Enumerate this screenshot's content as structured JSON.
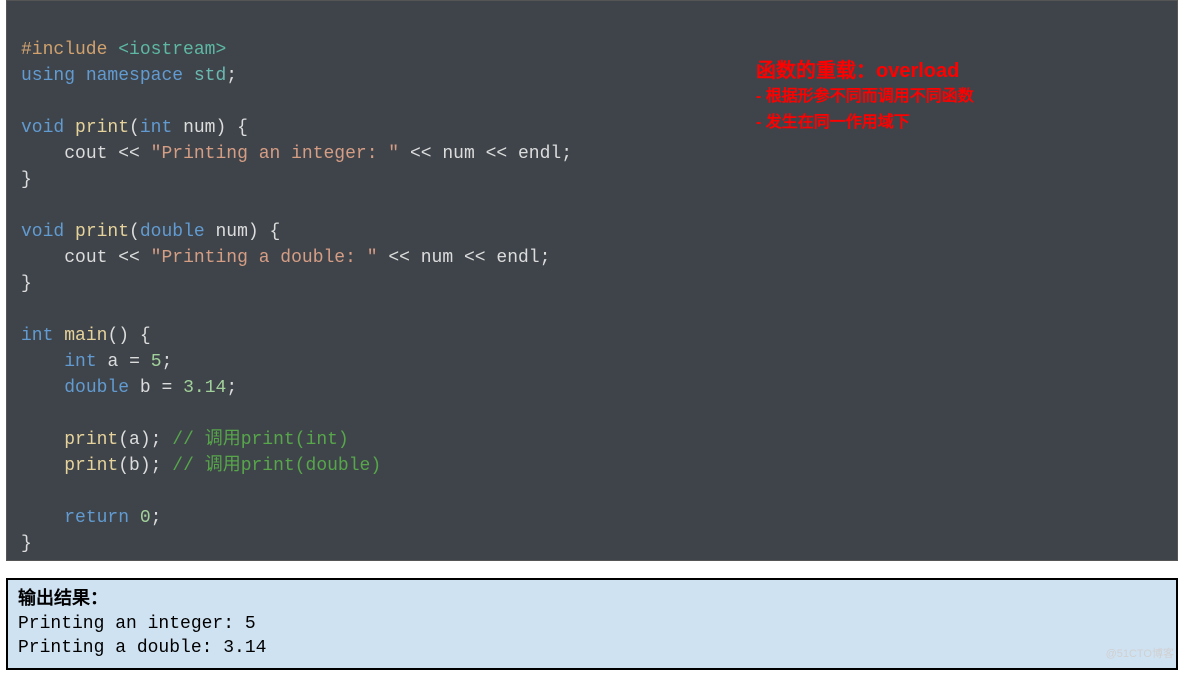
{
  "code": {
    "include_directive": "#include",
    "header": "<iostream>",
    "kw_using": "using",
    "kw_namespace": "namespace",
    "ns": "std",
    "semi": ";",
    "kw_void": "void",
    "fn_print": "print",
    "lparen": "(",
    "rparen": ")",
    "lbrace": "{",
    "rbrace": "}",
    "kw_int": "int",
    "kw_double": "double",
    "id_num": "num",
    "cout": "cout",
    "op_ins": "<<",
    "str_int": "\"Printing an integer: \"",
    "str_dbl": "\"Printing a double: \"",
    "endl": "endl",
    "fn_main": "main",
    "id_a": "a",
    "eq": "=",
    "lit_5": "5",
    "id_b": "b",
    "lit_314": "3.14",
    "cmt_int": "// 调用print(int)",
    "cmt_dbl": "// 调用print(double)",
    "kw_return": "return",
    "lit_0": "0"
  },
  "annotation": {
    "title": "函数的重载：overload",
    "line1": "- 根据形参不同而调用不同函数",
    "line2": "- 发生在同一作用域下"
  },
  "output": {
    "header": "输出结果：",
    "line1": "Printing an integer: 5",
    "line2": "Printing a double: 3.14"
  },
  "watermark": "@51CTO博客"
}
